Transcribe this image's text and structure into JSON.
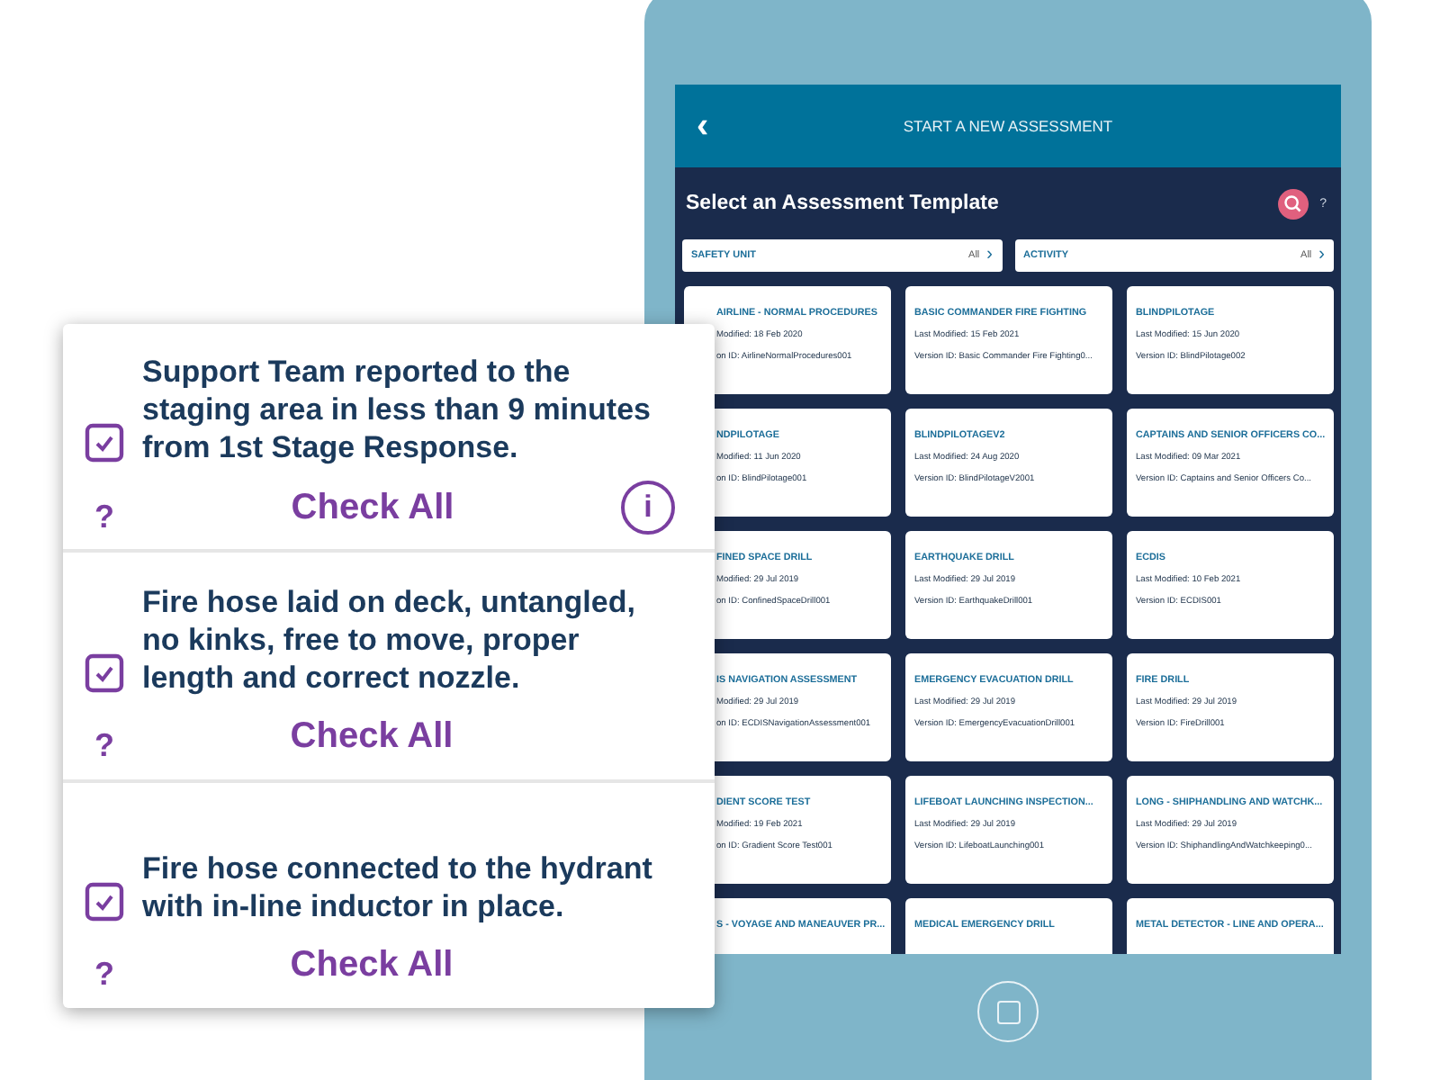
{
  "tablet": {
    "header": {
      "back": "‹",
      "title": "START A NEW ASSESSMENT"
    },
    "heading": "Select an Assessment Template",
    "help": "?",
    "filters": [
      {
        "label": "SAFETY UNIT",
        "value": "All",
        "chevron": "›"
      },
      {
        "label": "ACTIVITY",
        "value": "All",
        "chevron": "›"
      }
    ],
    "templates": [
      {
        "title": "AIRLINE - NORMAL PROCEDURES",
        "modified": "Modified: 18 Feb 2020",
        "version": "on ID: AirlineNormalProcedures001"
      },
      {
        "title": "BASIC COMMANDER FIRE FIGHTING",
        "modified": "Last Modified: 15 Feb 2021",
        "version": "Version ID: Basic Commander Fire Fighting0..."
      },
      {
        "title": "BLINDPILOTAGE",
        "modified": "Last Modified: 15 Jun 2020",
        "version": "Version ID: BlindPilotage002"
      },
      {
        "title": "NDPILOTAGE",
        "modified": "Modified: 11 Jun 2020",
        "version": "on ID: BlindPilotage001"
      },
      {
        "title": "BLINDPILOTAGEV2",
        "modified": "Last Modified: 24 Aug 2020",
        "version": "Version ID: BlindPilotageV2001"
      },
      {
        "title": "CAPTAINS AND SENIOR OFFICERS CO...",
        "modified": "Last Modified: 09 Mar 2021",
        "version": "Version ID: Captains and Senior Officers Co..."
      },
      {
        "title": "FINED SPACE DRILL",
        "modified": "Modified: 29 Jul 2019",
        "version": "on ID: ConfinedSpaceDrill001"
      },
      {
        "title": "EARTHQUAKE DRILL",
        "modified": "Last Modified: 29 Jul 2019",
        "version": "Version ID: EarthquakeDrill001"
      },
      {
        "title": "ECDIS",
        "modified": "Last Modified: 10 Feb 2021",
        "version": "Version ID: ECDIS001"
      },
      {
        "title": "IS NAVIGATION ASSESSMENT",
        "modified": "Modified: 29 Jul 2019",
        "version": "on ID: ECDISNavigationAssessment001"
      },
      {
        "title": "EMERGENCY EVACUATION DRILL",
        "modified": "Last Modified: 29 Jul 2019",
        "version": "Version ID: EmergencyEvacuationDrill001"
      },
      {
        "title": "FIRE DRILL",
        "modified": "Last Modified: 29 Jul 2019",
        "version": "Version ID: FireDrill001"
      },
      {
        "title": "DIENT SCORE TEST",
        "modified": "Modified: 19 Feb 2021",
        "version": "on ID: Gradient Score Test001"
      },
      {
        "title": "LIFEBOAT LAUNCHING INSPECTION...",
        "modified": "Last Modified: 29 Jul 2019",
        "version": "Version ID: LifeboatLaunching001"
      },
      {
        "title": "LONG - SHIPHANDLING AND WATCHK...",
        "modified": "Last Modified: 29 Jul 2019",
        "version": "Version ID: ShiphandlingAndWatchkeeping0..."
      },
      {
        "title": "S - VOYAGE AND MANEAUVER PR..."
      },
      {
        "title": "MEDICAL EMERGENCY DRILL"
      },
      {
        "title": "METAL DETECTOR - LINE AND OPERA..."
      }
    ]
  },
  "checklist": {
    "items": [
      {
        "text": "Support Team reported to the staging area in less than 9 minutes from 1st Stage Response.",
        "checked": true,
        "help": "?",
        "action": "Check All",
        "info": "i"
      },
      {
        "text": "Fire hose laid on deck, untangled, no kinks, free to move,  proper length and correct nozzle.",
        "checked": true,
        "help": "?",
        "action": "Check All"
      },
      {
        "text": "Fire hose connected to the hydrant with in-line inductor in place.",
        "checked": true,
        "help": "?",
        "action": "Check All"
      }
    ]
  }
}
